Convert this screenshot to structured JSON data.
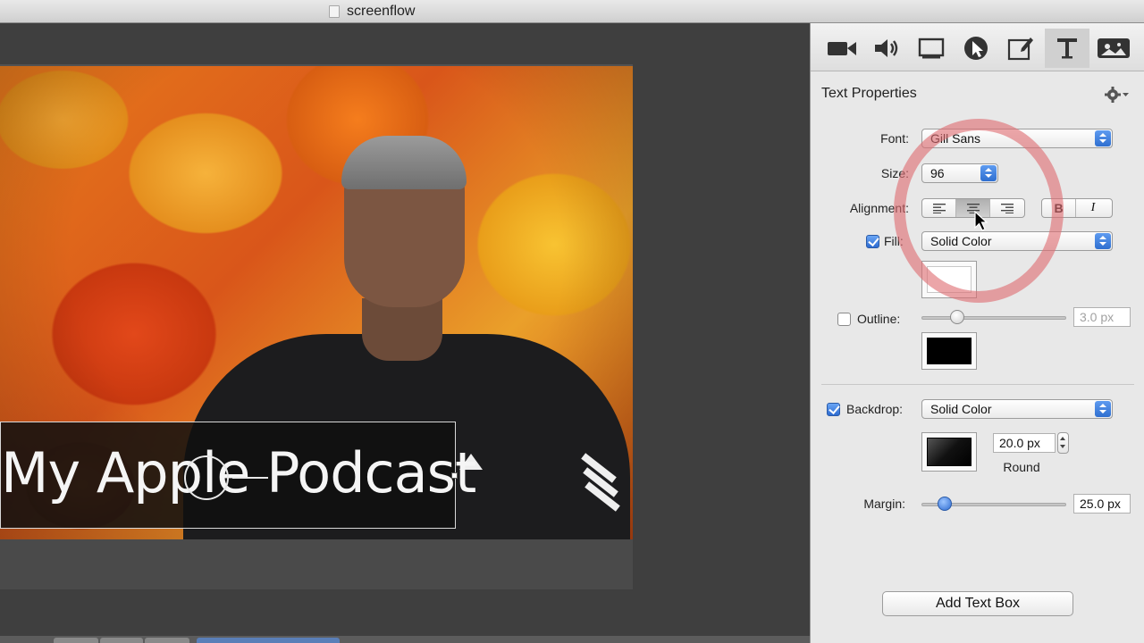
{
  "window": {
    "title": "screenflow"
  },
  "canvas": {
    "title_text": "My Apple Podcast"
  },
  "inspector": {
    "tabs": [
      "video-properties",
      "audio-properties",
      "screen-recording-properties",
      "callout-properties",
      "annotation-properties",
      "text-properties",
      "media-library"
    ],
    "active_tab": "text-properties",
    "heading": "Text Properties",
    "font": {
      "label": "Font:",
      "value": "Gill Sans"
    },
    "size": {
      "label": "Size:",
      "value": "96"
    },
    "alignment": {
      "label": "Alignment:",
      "options": [
        "left",
        "center",
        "right"
      ],
      "selected": "center",
      "bold": "B",
      "italic": "I"
    },
    "fill": {
      "label": "Fill:",
      "checked": true,
      "value": "Solid Color",
      "color": "#ffffff"
    },
    "outline": {
      "label": "Outline:",
      "checked": false,
      "width": "3.0 px",
      "color": "#000000",
      "level": 0.22
    },
    "backdrop": {
      "label": "Backdrop:",
      "checked": true,
      "value": "Solid Color",
      "corner_radius": "20.0 px",
      "corner_style": "Round"
    },
    "margin": {
      "label": "Margin:",
      "value": "25.0 px",
      "level": 0.12
    },
    "add_button": "Add Text Box"
  }
}
